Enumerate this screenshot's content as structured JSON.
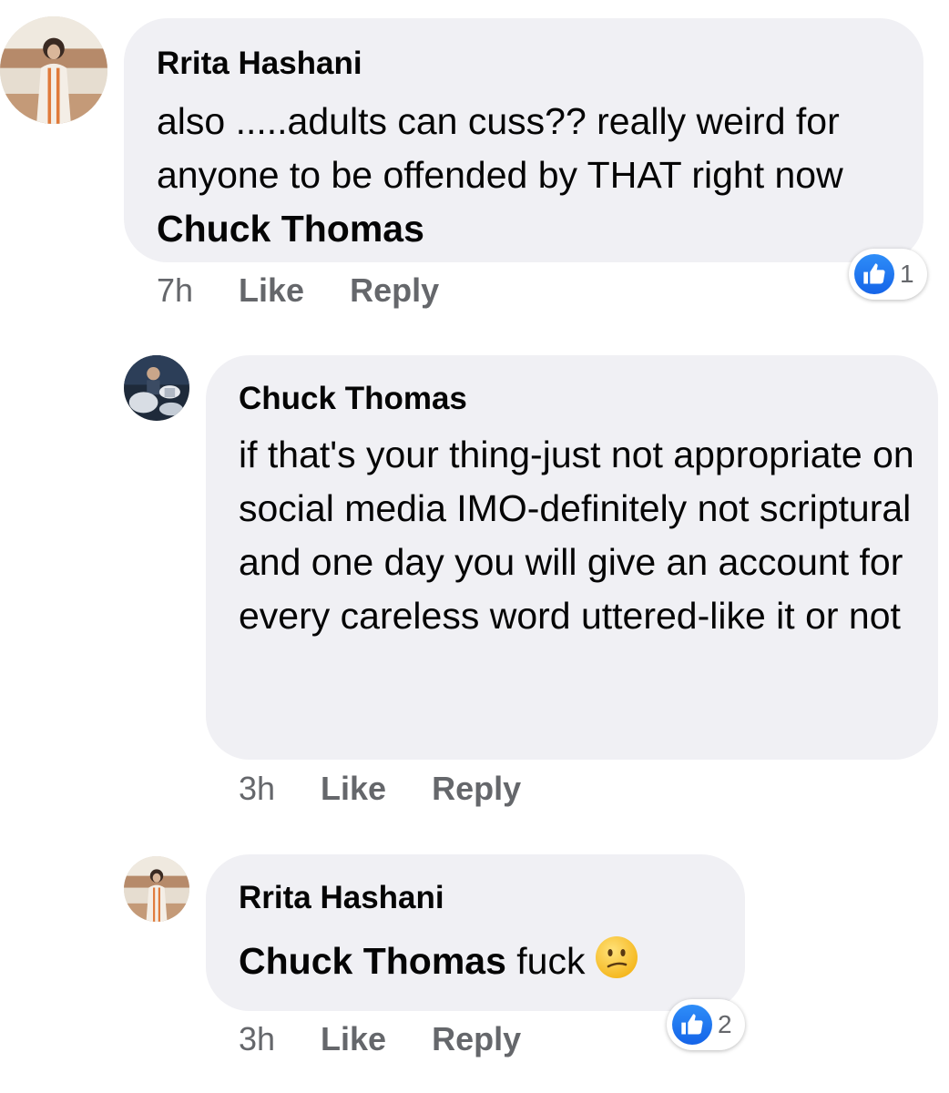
{
  "comments": [
    {
      "author": "Rrita Hashani",
      "text": "also .....adults can cuss?? really weird for anyone to be offended by THAT right now ",
      "mention": "Chuck Thomas",
      "time": "7h",
      "like_label": "Like",
      "reply_label": "Reply",
      "reaction_count": "1",
      "reaction_icon": "like-icon"
    },
    {
      "author": "Chuck Thomas",
      "text": "if that's your thing-just not appropriate on social media IMO-definitely not scriptural and one day you will give an account for every careless word uttered-like it or not",
      "time": "3h",
      "like_label": "Like",
      "reply_label": "Reply"
    },
    {
      "author": "Rrita Hashani",
      "mention": "Chuck Thomas",
      "text": " fuck",
      "emoji": "confused-face-emoji",
      "time": "3h",
      "like_label": "Like",
      "reply_label": "Reply",
      "reaction_count": "2",
      "reaction_icon": "like-icon"
    }
  ],
  "colors": {
    "bubble": "#f0f0f4",
    "meta_text": "#65676b",
    "like_blue": "#1877f2"
  }
}
